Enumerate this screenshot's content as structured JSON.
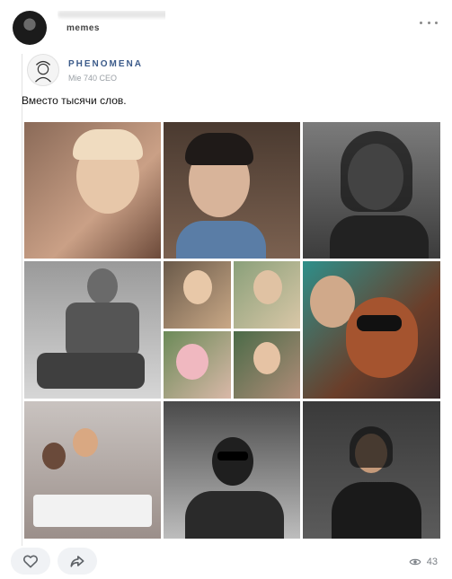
{
  "header": {
    "group_label": "memes",
    "more_icon": "more-horizontal-icon"
  },
  "repost": {
    "author": "PHENOMENA",
    "date": "Mie 740 CEO",
    "text": "Вместо тысячи слов."
  },
  "footer": {
    "views": "43",
    "like_icon": "heart-outline-icon",
    "share_icon": "share-arrow-icon",
    "views_icon": "eye-icon"
  },
  "colors": {
    "link": "#3c5b8a",
    "muted": "#7a7f85",
    "button_bg": "#f0f2f5"
  }
}
